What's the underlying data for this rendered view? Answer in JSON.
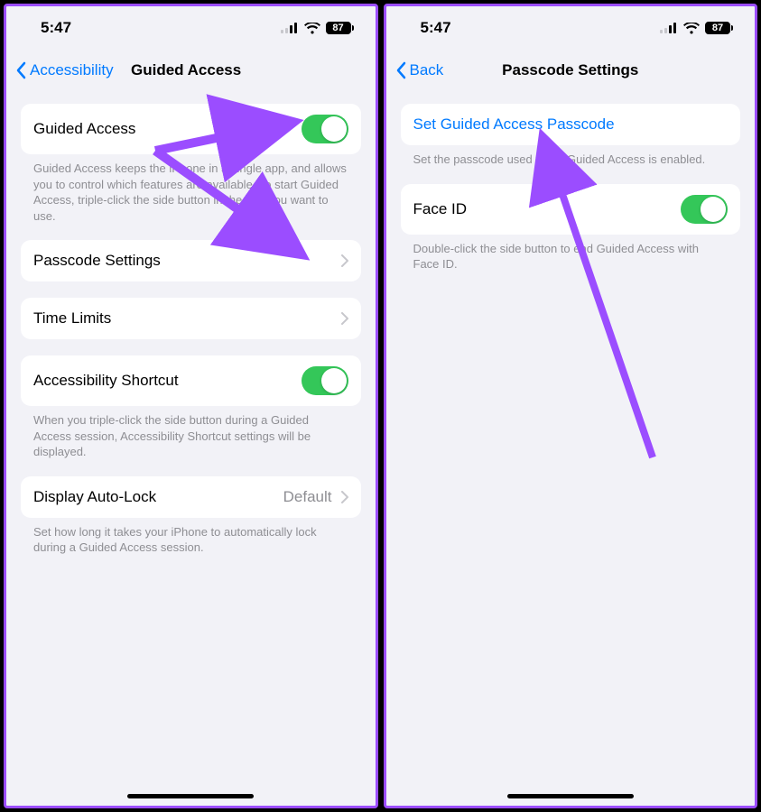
{
  "left": {
    "status": {
      "time": "5:47",
      "battery": "87"
    },
    "nav": {
      "back": "Accessibility",
      "title": "Guided Access"
    },
    "guided_access": {
      "label": "Guided Access",
      "footer": "Guided Access keeps the iPhone in a single app, and allows you to control which features are available. To start Guided Access, triple-click the side button in the app you want to use.",
      "toggle": true
    },
    "passcode_settings": {
      "label": "Passcode Settings"
    },
    "time_limits": {
      "label": "Time Limits"
    },
    "accessibility_shortcut": {
      "label": "Accessibility Shortcut",
      "footer": "When you triple-click the side button during a Guided Access session, Accessibility Shortcut settings will be displayed.",
      "toggle": true
    },
    "display_autolock": {
      "label": "Display Auto-Lock",
      "value": "Default",
      "footer": "Set how long it takes your iPhone to automatically lock during a Guided Access session."
    }
  },
  "right": {
    "status": {
      "time": "5:47",
      "battery": "87"
    },
    "nav": {
      "back": "Back",
      "title": "Passcode Settings"
    },
    "set_passcode": {
      "label": "Set Guided Access Passcode",
      "footer": "Set the passcode used when Guided Access is enabled."
    },
    "face_id": {
      "label": "Face ID",
      "footer": "Double-click the side button to end Guided Access with Face ID.",
      "toggle": true
    }
  }
}
